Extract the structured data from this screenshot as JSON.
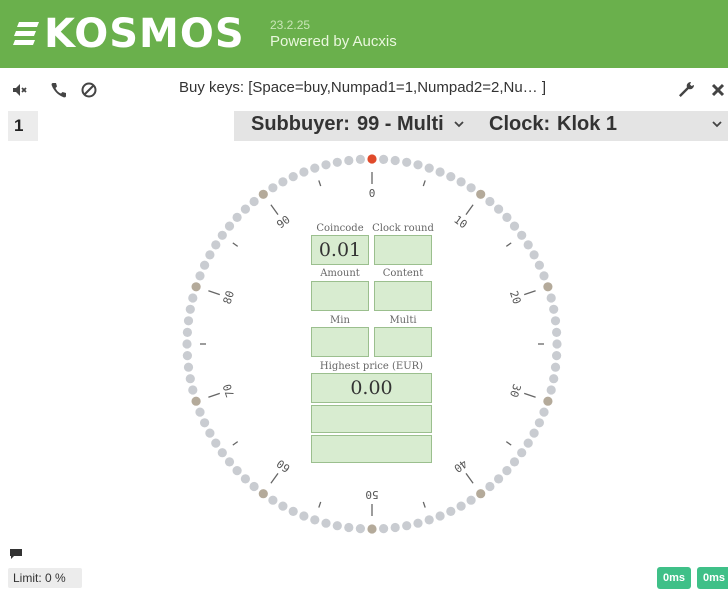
{
  "app": {
    "name": "KOSMOS",
    "version": "23.2.25",
    "powered_by": "Powered by Aucxis",
    "brand_color": "#6ab04c"
  },
  "toolbar": {
    "icons": [
      "mute-icon",
      "phone-icon",
      "block-icon",
      "wrench-icon",
      "close-icon"
    ],
    "buy_keys": "Buy keys: [Space=buy,Numpad1=1,Numpad2=2,Nu… ]"
  },
  "lot_number": "1",
  "subbuyer": {
    "label": "Subbuyer:",
    "value": "99 - Multi"
  },
  "clock_select": {
    "label": "Clock:",
    "value": "Klok 1"
  },
  "clock": {
    "major_labels": [
      "0",
      "10",
      "20",
      "30",
      "40",
      "50",
      "60",
      "70",
      "80",
      "90"
    ],
    "pointer_position": 0,
    "fields": {
      "coincode": {
        "label": "Coincode",
        "value": "0.01"
      },
      "clock_round": {
        "label": "Clock round",
        "value": ""
      },
      "amount": {
        "label": "Amount",
        "value": ""
      },
      "content": {
        "label": "Content",
        "value": ""
      },
      "min": {
        "label": "Min",
        "value": ""
      },
      "multi": {
        "label": "Multi",
        "value": ""
      },
      "highest_price": {
        "label": "Highest price (EUR)",
        "value": "0.00"
      },
      "extra1": {
        "value": ""
      },
      "extra2": {
        "value": ""
      }
    },
    "colors": {
      "dot": "#c9ccd1",
      "major_dot": "#b4aa9a",
      "pointer": "#e04a2a"
    }
  },
  "footer": {
    "limit": "Limit: 0 %",
    "latency": [
      "0ms",
      "0ms"
    ]
  }
}
